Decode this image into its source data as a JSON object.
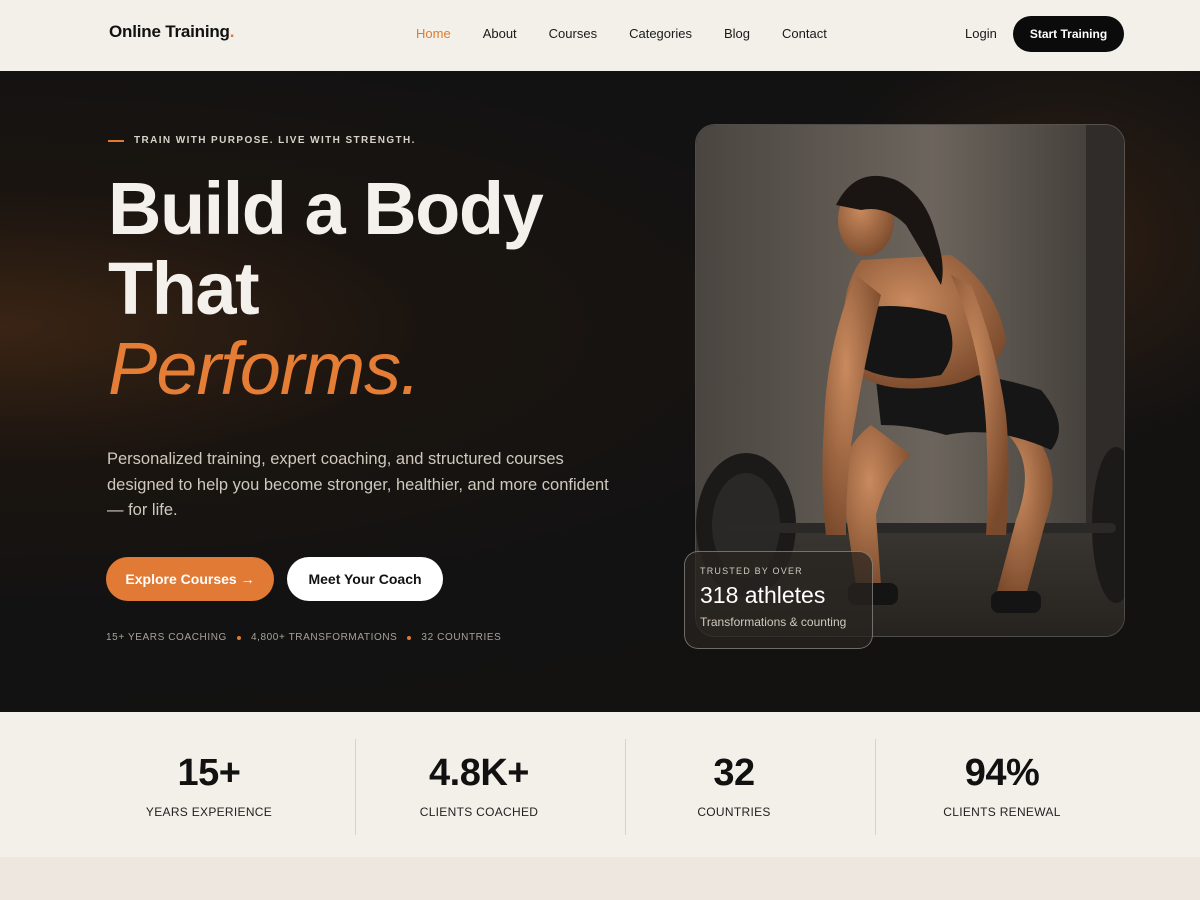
{
  "nav": {
    "logo": "Online Training",
    "logo_dot": ".",
    "items": [
      "Home",
      "About",
      "Courses",
      "Categories",
      "Blog",
      "Contact"
    ],
    "active": "Home",
    "login": "Login",
    "cta": "Start Training"
  },
  "hero": {
    "eyebrow": "TRAIN WITH PURPOSE. LIVE WITH STRENGTH.",
    "headline_1": "Build a Body",
    "headline_2": "That",
    "headline_3": "Performs.",
    "lede": "Personalized training, expert coaching, and structured courses designed to help you become stronger, healthier, and more confident — for life.",
    "btn_primary": "Explore Courses →",
    "btn_secondary": "Meet Your Coach",
    "meta": [
      "15+ YEARS COACHING",
      "4,800+ TRANSFORMATIONS",
      "32 COUNTRIES"
    ],
    "photo_icon": "athlete-deadlift-photo",
    "trust": {
      "label": "TRUSTED BY OVER",
      "value": "318 athletes",
      "sub": "Transformations & counting"
    }
  },
  "stats": [
    {
      "value": "15+",
      "label": "YEARS EXPERIENCE"
    },
    {
      "value": "4.8K+",
      "label": "CLIENTS COACHED"
    },
    {
      "value": "32",
      "label": "COUNTRIES"
    },
    {
      "value": "94%",
      "label": "CLIENTS RENEWAL"
    }
  ],
  "colors": {
    "accent": "#e07a2e",
    "dark": "#121212",
    "light": "#f3f0ea"
  }
}
